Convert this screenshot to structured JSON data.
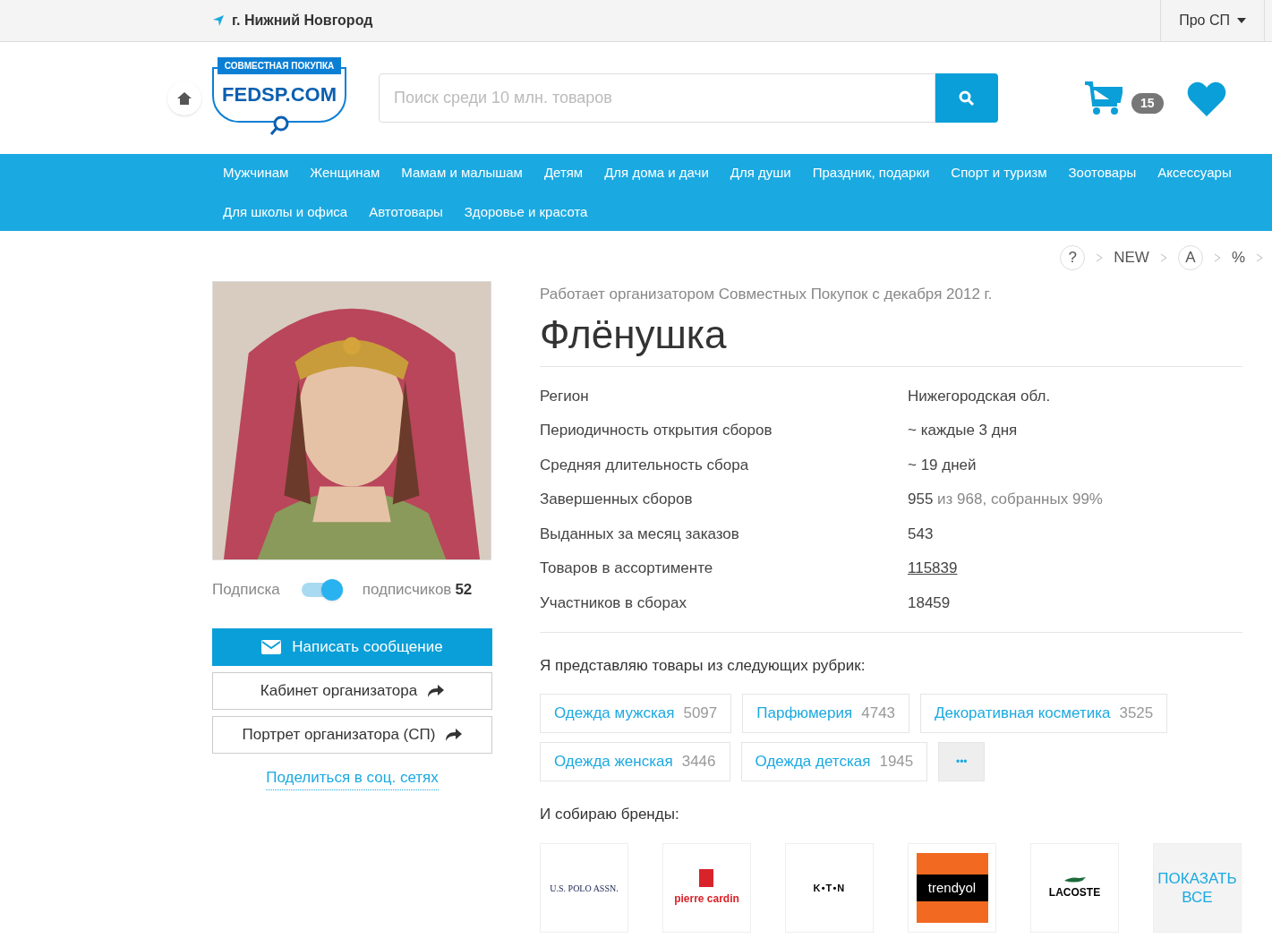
{
  "topbar": {
    "city": "г. Нижний Новгород",
    "menu": "Про СП"
  },
  "header": {
    "logo_top": "СОВМЕСТНАЯ ПОКУПКА",
    "logo_main": "FEDSP.COM",
    "search_placeholder": "Поиск среди 10 млн. товаров",
    "cart_count": "15"
  },
  "nav": [
    "Мужчинам",
    "Женщинам",
    "Мамам и малышам",
    "Детям",
    "Для дома и дачи",
    "Для души",
    "Праздник, подарки",
    "Спорт и туризм",
    "Зоотовары",
    "Аксессуары",
    "Для школы и офиса",
    "Автотовары",
    "Здоровье и красота"
  ],
  "breadcrumbs": [
    {
      "label": "?",
      "kind": "circle"
    },
    {
      "label": "NEW",
      "kind": "text"
    },
    {
      "label": "A",
      "kind": "circle"
    },
    {
      "label": "%",
      "kind": "text"
    }
  ],
  "profile": {
    "since": "Работает организатором Совместных Покупок с декабря 2012 г.",
    "name": "Флёнушка",
    "subscribe_label": "Подписка",
    "subscribed": true,
    "subscribers_label": "подписчиков",
    "subscribers_count": "52",
    "buttons": [
      {
        "label": "Написать сообщение",
        "kind": "primary"
      },
      {
        "label": "Кабинет организатора",
        "kind": "link"
      },
      {
        "label": "Портрет организатора (СП)",
        "kind": "link"
      }
    ],
    "share": "Поделиться в соц. сетях"
  },
  "stats": [
    {
      "label": "Регион",
      "value": "Нижегородская обл.",
      "kind": "plain"
    },
    {
      "label": "Периодичность открытия сборов",
      "value": "~ каждые 3 дня",
      "kind": "plain"
    },
    {
      "label": "Средняя длительность сбора",
      "value": "~ 19 дней",
      "kind": "plain"
    },
    {
      "label": "Завершенных сборов",
      "value": "955",
      "extra": "из 968, собранных 99%",
      "kind": "plain"
    },
    {
      "label": "Выданных за месяц заказов",
      "value": "543",
      "kind": "plain"
    },
    {
      "label": "Товаров в ассортименте",
      "value": "115839",
      "kind": "link"
    },
    {
      "label": "Участников в сборах",
      "value": "18459",
      "kind": "plain"
    }
  ],
  "rubrics_title": "Я представляю товары из следующих рубрик:",
  "rubrics": [
    {
      "name": "Одежда мужская",
      "count": "5097"
    },
    {
      "name": "Парфюмерия",
      "count": "4743"
    },
    {
      "name": "Декоративная косметика",
      "count": "3525"
    },
    {
      "name": "Одежда женская",
      "count": "3446"
    },
    {
      "name": "Одежда детская",
      "count": "1945"
    }
  ],
  "more": "•••",
  "brands_title": "И собираю бренды:",
  "brands": [
    {
      "logo": "U.S. POLO ASSN.",
      "kind": "polo"
    },
    {
      "logo": "pierre cardin",
      "kind": "cardin"
    },
    {
      "logo": "K•T•N",
      "kind": "koton"
    },
    {
      "logo": "trendyol",
      "kind": "trendyol"
    },
    {
      "logo": "LACOSTE",
      "kind": "lacoste"
    }
  ],
  "show_all": "ПОКАЗАТЬ ВСЕ"
}
